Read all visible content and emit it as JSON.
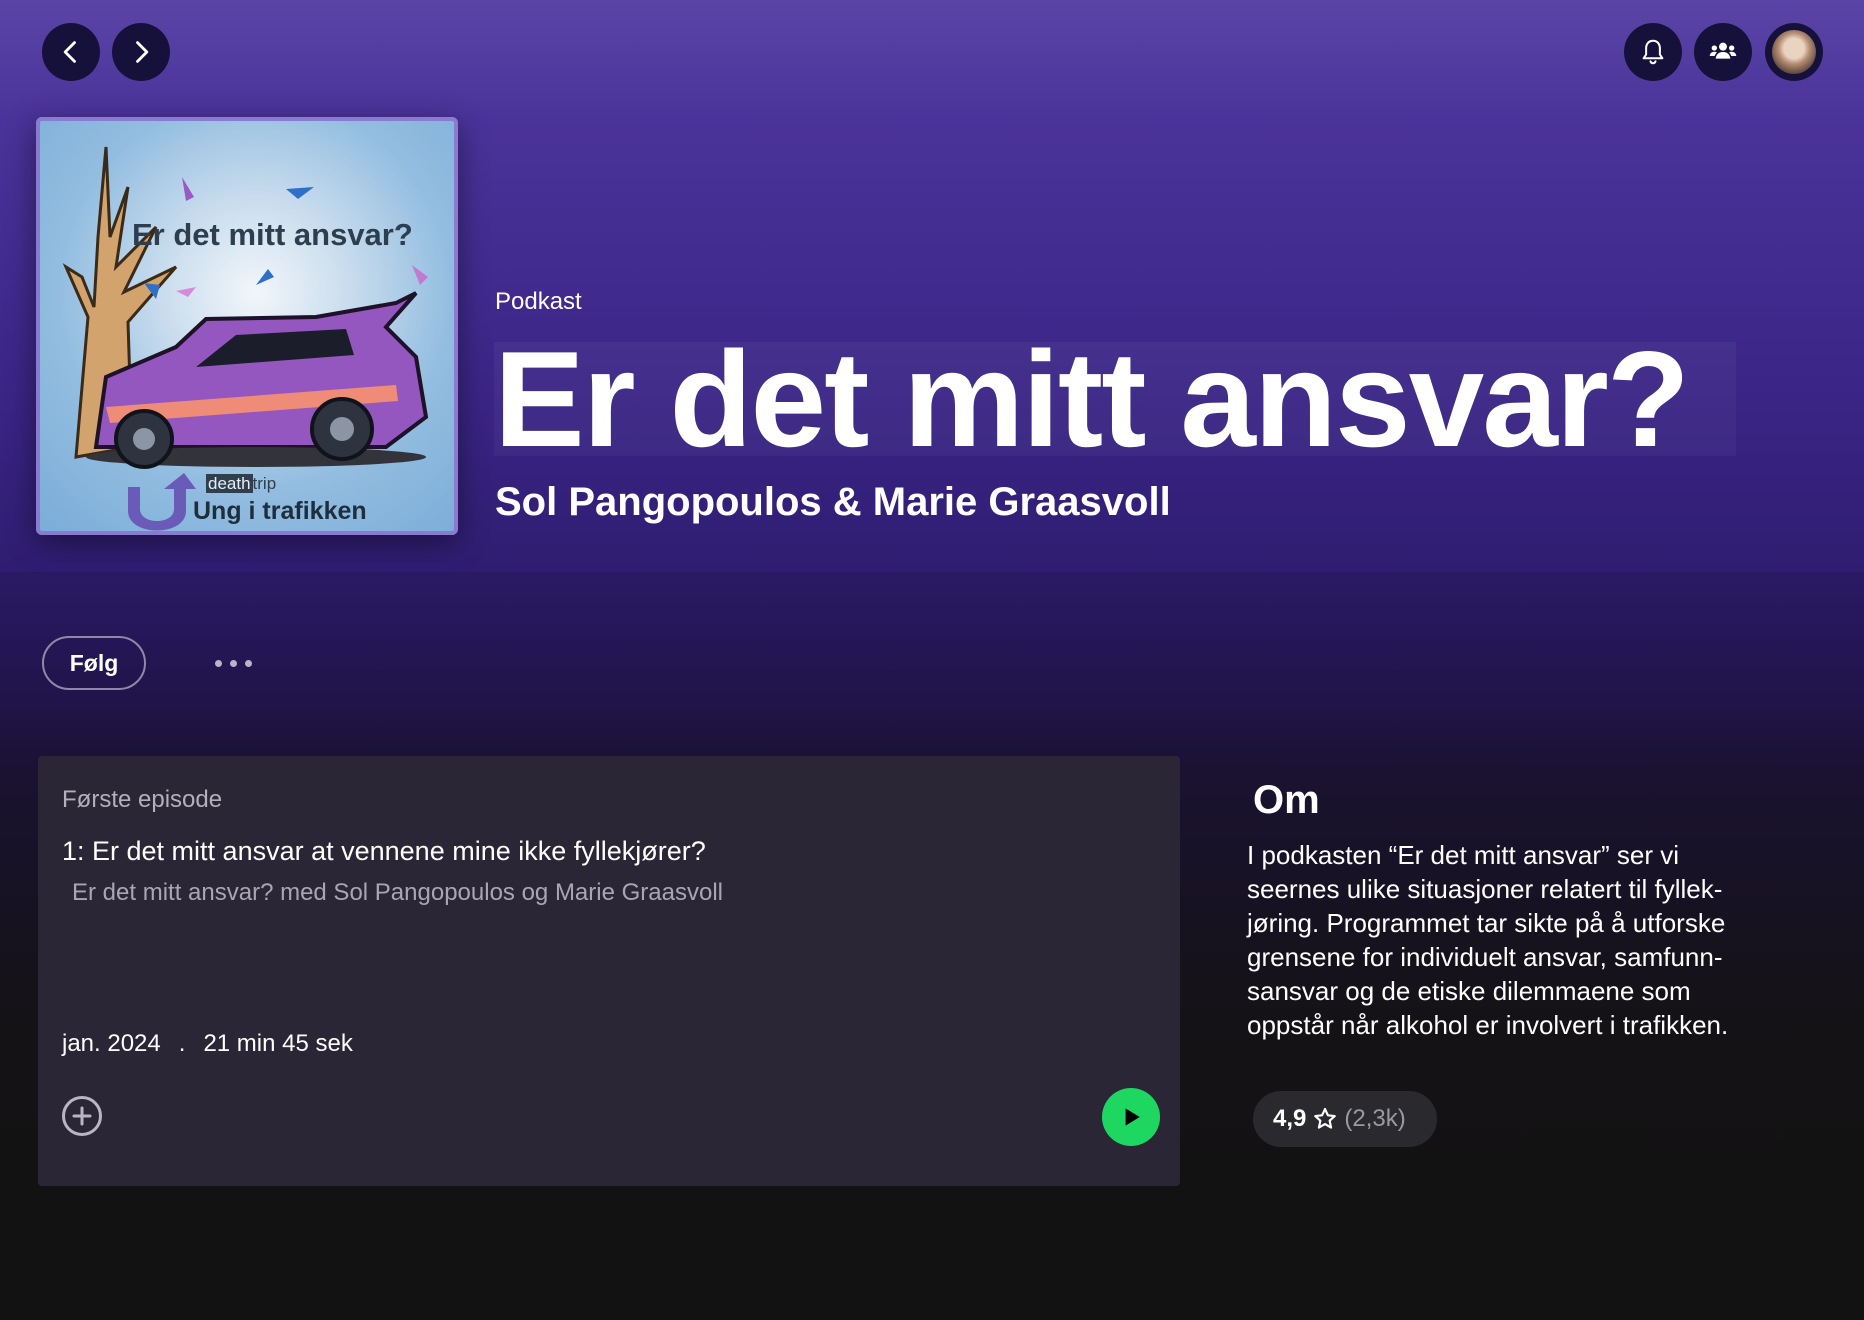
{
  "nav": {
    "back_label": "Back",
    "forward_label": "Forward"
  },
  "topbar": {
    "icons": [
      "bell-icon",
      "friends-icon",
      "avatar"
    ]
  },
  "cover": {
    "title": "Er det mitt ansvar?",
    "brand_small_tag": "death",
    "brand_small_rest": "trip",
    "brand_sub": "Ung i trafikken"
  },
  "header": {
    "type": "Podkast",
    "title": "Er det mitt ansvar?",
    "authors": "Sol Pangopoulos & Marie Graasvoll"
  },
  "actions": {
    "follow_label": "Følg"
  },
  "episode": {
    "label": "Første episode",
    "title": "1: Er det mitt ansvar at vennene mine ikke fyllekjører?",
    "show_line": "Er det mitt ansvar? med Sol Pangopoulos og Marie Graasvoll",
    "date": "jan. 2024",
    "separator": ".",
    "duration": "21 min 45 sek"
  },
  "about": {
    "heading": "Om",
    "lines": [
      "I podkasten “Er det mitt ansvar” ser vi",
      "seernes ulike situasjoner relatert til fyllek-",
      "jøring. Programmet tar sikte på å utforske",
      "grensene for individuelt ansvar, samfunn-",
      "sansvar og de etiske dilemmaene som",
      "oppstår når alkohol er involvert i trafikken."
    ]
  },
  "rating": {
    "score": "4,9",
    "count": "(2,3k)"
  },
  "colors": {
    "accent": "#1ed760",
    "hero_purple": "#4a339a"
  }
}
